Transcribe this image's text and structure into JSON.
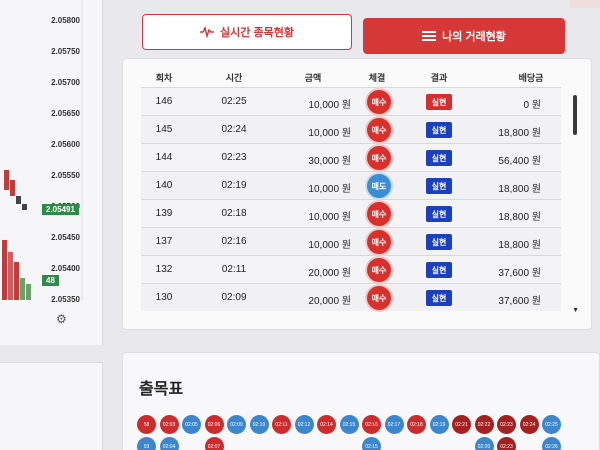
{
  "left_chart": {
    "price_labels": [
      "2.05800",
      "2.05750",
      "2.05700",
      "2.05650",
      "2.05600",
      "2.05550",
      "2.05500",
      "2.05450",
      "2.05400",
      "2.05350"
    ],
    "current_price": "2.05491",
    "countdown": "48"
  },
  "buttons": {
    "live_label": "실시간 종목현황",
    "my_label": "나의 거래현황"
  },
  "table": {
    "headers": [
      "회차",
      "시간",
      "금액",
      "체결",
      "결과",
      "배당금"
    ],
    "rows": [
      {
        "round": "146",
        "time": "02:25",
        "amount": "10,000 원",
        "side": "매수",
        "side_type": "buy",
        "result": "실현",
        "result_type": "fail",
        "payout": "0 원"
      },
      {
        "round": "145",
        "time": "02:24",
        "amount": "10,000 원",
        "side": "매수",
        "side_type": "buy",
        "result": "실현",
        "result_type": "ok",
        "payout": "18,800 원"
      },
      {
        "round": "144",
        "time": "02:23",
        "amount": "30,000 원",
        "side": "매수",
        "side_type": "buy",
        "result": "실현",
        "result_type": "ok",
        "payout": "56,400 원"
      },
      {
        "round": "140",
        "time": "02:19",
        "amount": "10,000 원",
        "side": "매도",
        "side_type": "sell",
        "result": "실현",
        "result_type": "ok",
        "payout": "18,800 원"
      },
      {
        "round": "139",
        "time": "02:18",
        "amount": "10,000 원",
        "side": "매수",
        "side_type": "buy",
        "result": "실현",
        "result_type": "ok",
        "payout": "18,800 원"
      },
      {
        "round": "137",
        "time": "02:16",
        "amount": "10,000 원",
        "side": "매수",
        "side_type": "buy",
        "result": "실현",
        "result_type": "ok",
        "payout": "18,800 원"
      },
      {
        "round": "132",
        "time": "02:11",
        "amount": "20,000 원",
        "side": "매수",
        "side_type": "buy",
        "result": "실현",
        "result_type": "ok",
        "payout": "37,600 원"
      },
      {
        "round": "130",
        "time": "02:09",
        "amount": "20,000 원",
        "side": "매수",
        "side_type": "buy",
        "result": "실현",
        "result_type": "ok",
        "payout": "37,600 원"
      }
    ]
  },
  "history": {
    "title": "출목표",
    "row1": [
      {
        "t": "58",
        "c": "r"
      },
      {
        "t": "02:03",
        "c": "r"
      },
      {
        "t": "02:05",
        "c": "b"
      },
      {
        "t": "02:06",
        "c": "r"
      },
      {
        "t": "02:09",
        "c": "b"
      },
      {
        "t": "02:10",
        "c": "b"
      },
      {
        "t": "02:11",
        "c": "r"
      },
      {
        "t": "02:12",
        "c": "b"
      },
      {
        "t": "02:14",
        "c": "r"
      },
      {
        "t": "02:15",
        "c": "b"
      },
      {
        "t": "02:16",
        "c": "r"
      },
      {
        "t": "02:17",
        "c": "b"
      },
      {
        "t": "02:18",
        "c": "r"
      },
      {
        "t": "02:19",
        "c": "b"
      },
      {
        "t": "02:21",
        "c": "dr"
      },
      {
        "t": "02:22",
        "c": "dr"
      },
      {
        "t": "02:23",
        "c": "dr"
      },
      {
        "t": "02:24",
        "c": "dr"
      },
      {
        "t": "02:25",
        "c": "b"
      }
    ],
    "row2": [
      {
        "t": "59",
        "c": "b"
      },
      {
        "t": "02:04",
        "c": "b"
      },
      {
        "t": "02:07",
        "c": "r"
      },
      {
        "t": "02:15",
        "c": "b"
      },
      {
        "t": "02:20",
        "c": "b"
      },
      {
        "t": "02:23",
        "c": "dr"
      },
      {
        "t": "02:26",
        "c": "b"
      }
    ]
  },
  "colors": {
    "accent_red": "#d63838",
    "buy_red": "#d9302c",
    "sell_blue": "#3b8dd6",
    "result_blue": "#1b3fbf"
  }
}
